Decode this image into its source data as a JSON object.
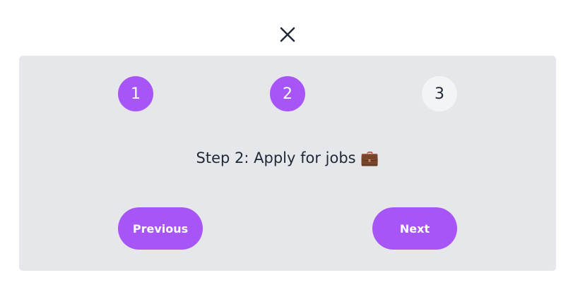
{
  "dialog": {
    "close_icon": "close-icon"
  },
  "stepper": {
    "steps": [
      {
        "label": "1",
        "state": "completed"
      },
      {
        "label": "2",
        "state": "current"
      },
      {
        "label": "3",
        "state": "upcoming"
      }
    ],
    "current_step_title": "Step 2: Apply for jobs 💼"
  },
  "navigation": {
    "previous_label": "Previous",
    "next_label": "Next"
  },
  "colors": {
    "accent": "#a855f7",
    "panel_bg": "#e5e7eb",
    "inactive_step_bg": "#f3f4f6",
    "text_dark": "#1f2937"
  }
}
